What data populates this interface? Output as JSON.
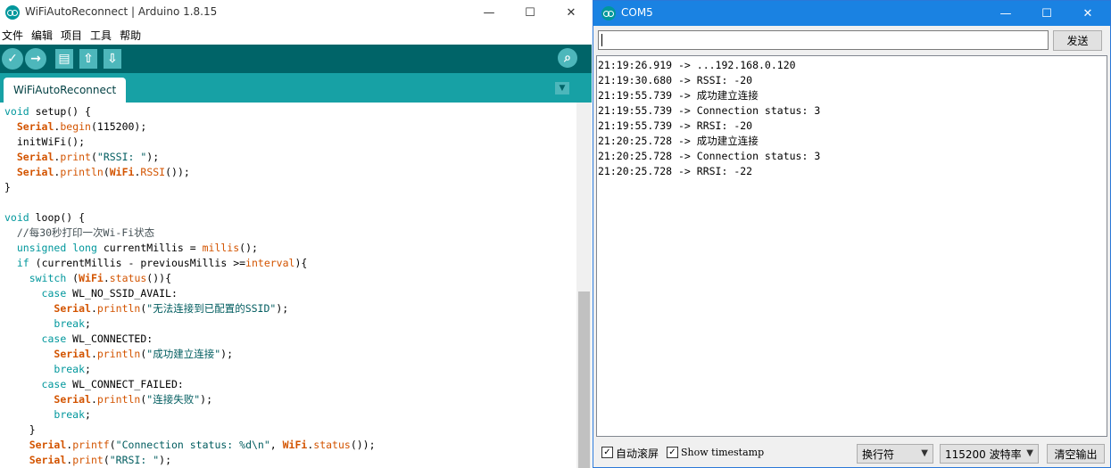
{
  "ide": {
    "title": "WiFiAutoReconnect | Arduino 1.8.15",
    "window_controls": {
      "minimize": "—",
      "maximize": "☐",
      "close": "✕"
    },
    "menu": [
      "文件",
      "编辑",
      "项目",
      "工具",
      "帮助"
    ],
    "toolbar_icons": [
      "verify-icon",
      "upload-icon",
      "new-icon",
      "open-icon",
      "save-icon",
      "serial-monitor-icon"
    ],
    "tab_label": "WiFiAutoReconnect",
    "code_lines": [
      "void setup() {",
      "  Serial.begin(115200);",
      "  initWiFi();",
      "  Serial.print(\"RSSI: \");",
      "  Serial.println(WiFi.RSSI());",
      "}",
      "",
      "void loop() {",
      "  //每30秒打印一次Wi-Fi状态",
      "  unsigned long currentMillis = millis();",
      "  if (currentMillis - previousMillis >=interval){",
      "    switch (WiFi.status()){",
      "      case WL_NO_SSID_AVAIL:",
      "        Serial.println(\"无法连接到已配置的SSID\");",
      "        break;",
      "      case WL_CONNECTED:",
      "        Serial.println(\"成功建立连接\");",
      "        break;",
      "      case WL_CONNECT_FAILED:",
      "        Serial.println(\"连接失败\");",
      "        break;",
      "    }",
      "    Serial.printf(\"Connection status: %d\\n\", WiFi.status());",
      "    Serial.print(\"RRSI: \");"
    ]
  },
  "serial": {
    "title": "COM5",
    "window_controls": {
      "minimize": "—",
      "maximize": "☐",
      "close": "✕"
    },
    "input_value": "",
    "send_label": "发送",
    "output_lines": [
      "21:19:26.919 -> ...192.168.0.120",
      "21:19:30.680 -> RSSI: -20",
      "21:19:55.739 -> 成功建立连接",
      "21:19:55.739 -> Connection status: 3",
      "21:19:55.739 -> RRSI: -20",
      "21:20:25.728 -> 成功建立连接",
      "21:20:25.728 -> Connection status: 3",
      "21:20:25.728 -> RRSI: -22"
    ],
    "autoscroll_label": "自动滚屏",
    "autoscroll_checked": true,
    "timestamp_label": "Show timestamp",
    "timestamp_checked": true,
    "line_ending_selected": "换行符",
    "baud_selected": "115200 波特率",
    "clear_label": "清空输出"
  },
  "colors": {
    "toolbar": "#006468",
    "tabbar": "#17a1a5",
    "icon_fill": "#4db7bb",
    "serial_titlebar": "#1a82e2",
    "keyword": "#00979c",
    "object": "#d35400",
    "string": "#005c5f"
  }
}
